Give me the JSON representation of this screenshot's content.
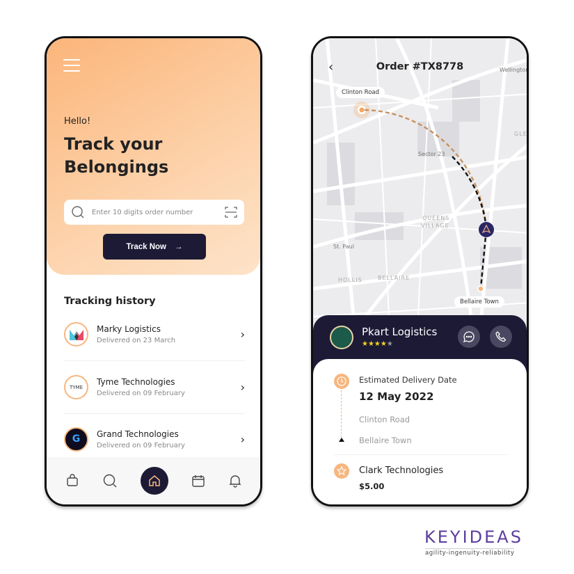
{
  "home": {
    "greeting": "Hello!",
    "title": "Track your Belongings",
    "search_placeholder": "Enter 10 digits order number",
    "track_button": "Track Now",
    "history_title": "Tracking history",
    "history": [
      {
        "name": "Marky Logistics",
        "status": "Delivered on 23 March",
        "logo": "M"
      },
      {
        "name": "Tyme Technologies",
        "status": "Delivered on 09 February",
        "logo": "TYME"
      },
      {
        "name": "Grand Technologies",
        "status": "Delivered on 09 February",
        "logo": "G"
      }
    ],
    "nav": [
      "bag-icon",
      "search-icon",
      "home-icon",
      "calendar-icon",
      "bell-icon"
    ],
    "active_nav": "home-icon"
  },
  "order": {
    "title": "Order #TX8778",
    "map_labels": [
      "Wellington",
      "Sector 23",
      "QUEENS",
      "VILLAGE",
      "St. Paul",
      "HOLLIS",
      "BELLAIRE",
      "GLE"
    ],
    "origin": "Clinton Road",
    "destination": "Bellaire Town",
    "carrier": {
      "name": "Pkart Logistics",
      "rating": 4,
      "max_rating": 5
    },
    "estimated_label": "Estimated Delivery Date",
    "estimated_date": "12 May 2022",
    "from": "Clinton Road",
    "to": "Bellaire Town",
    "company": "Clark Technologies",
    "price": "$5.00"
  },
  "brand": {
    "name": "KEYIDEAS",
    "tagline": "agility-ingenuity-reliability"
  },
  "colors": {
    "accent": "#f7b67f",
    "dark": "#1d1a36",
    "brand": "#5b3d9e"
  }
}
